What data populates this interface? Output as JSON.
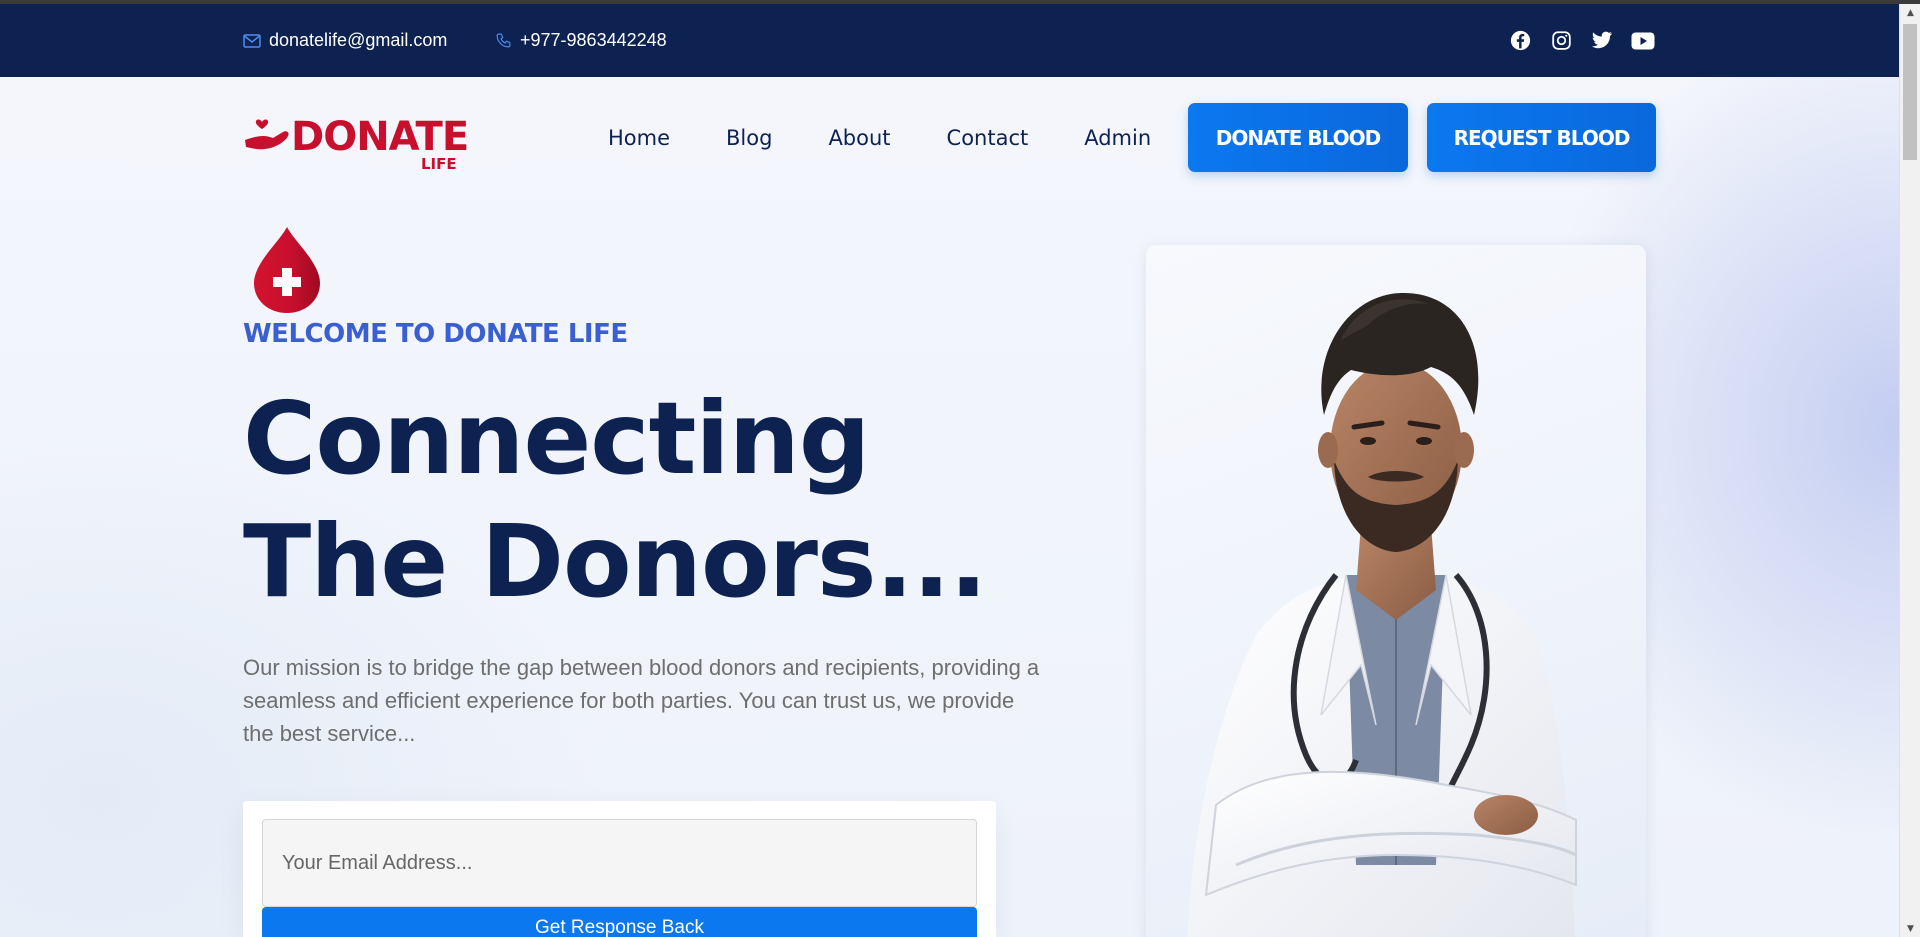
{
  "topbar": {
    "email": "donatelife@gmail.com",
    "phone": "+977-9863442248",
    "socials": [
      "facebook-icon",
      "instagram-icon",
      "twitter-icon",
      "youtube-icon"
    ]
  },
  "logo": {
    "main": "DONATE",
    "sub": "LIFE"
  },
  "nav": {
    "items": [
      "Home",
      "Blog",
      "About",
      "Contact",
      "Admin"
    ],
    "donate_button": "DONATE BLOOD",
    "request_button": "REQUEST BLOOD"
  },
  "hero": {
    "welcome": "WELCOME TO DONATE LIFE",
    "headline_line1": "Connecting",
    "headline_line2": "The Donors...",
    "mission": "Our mission is to bridge the gap between blood donors and recipients, providing a seamless and efficient experience for both parties. You can trust us, we provide the best service...",
    "email_placeholder": "Your Email Address...",
    "submit_label": "Get Response Back"
  },
  "colors": {
    "topbar": "#0d2250",
    "brand_red": "#c8102e",
    "accent_blue": "#0b78f0",
    "welcome_blue": "#3a5fd0",
    "headline": "#0d2250"
  }
}
